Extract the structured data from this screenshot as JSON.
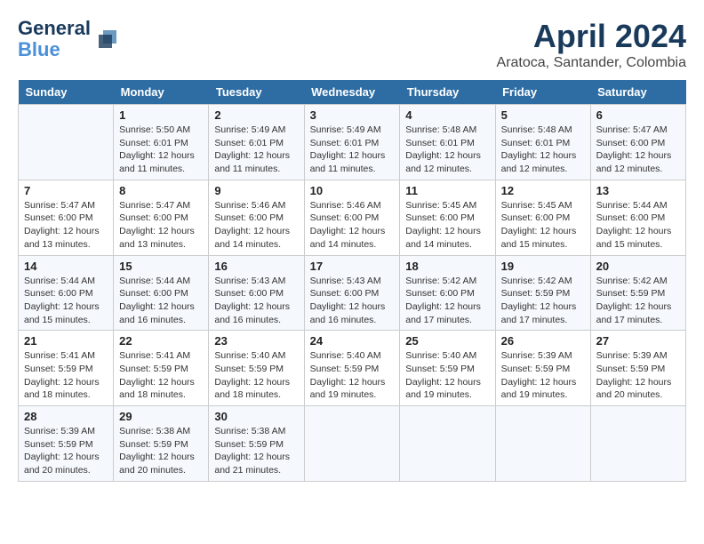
{
  "header": {
    "logo_line1": "General",
    "logo_line2": "Blue",
    "month": "April 2024",
    "location": "Aratoca, Santander, Colombia"
  },
  "weekdays": [
    "Sunday",
    "Monday",
    "Tuesday",
    "Wednesday",
    "Thursday",
    "Friday",
    "Saturday"
  ],
  "weeks": [
    [
      {
        "day": "",
        "info": ""
      },
      {
        "day": "1",
        "info": "Sunrise: 5:50 AM\nSunset: 6:01 PM\nDaylight: 12 hours\nand 11 minutes."
      },
      {
        "day": "2",
        "info": "Sunrise: 5:49 AM\nSunset: 6:01 PM\nDaylight: 12 hours\nand 11 minutes."
      },
      {
        "day": "3",
        "info": "Sunrise: 5:49 AM\nSunset: 6:01 PM\nDaylight: 12 hours\nand 11 minutes."
      },
      {
        "day": "4",
        "info": "Sunrise: 5:48 AM\nSunset: 6:01 PM\nDaylight: 12 hours\nand 12 minutes."
      },
      {
        "day": "5",
        "info": "Sunrise: 5:48 AM\nSunset: 6:01 PM\nDaylight: 12 hours\nand 12 minutes."
      },
      {
        "day": "6",
        "info": "Sunrise: 5:47 AM\nSunset: 6:00 PM\nDaylight: 12 hours\nand 12 minutes."
      }
    ],
    [
      {
        "day": "7",
        "info": "Sunrise: 5:47 AM\nSunset: 6:00 PM\nDaylight: 12 hours\nand 13 minutes."
      },
      {
        "day": "8",
        "info": "Sunrise: 5:47 AM\nSunset: 6:00 PM\nDaylight: 12 hours\nand 13 minutes."
      },
      {
        "day": "9",
        "info": "Sunrise: 5:46 AM\nSunset: 6:00 PM\nDaylight: 12 hours\nand 14 minutes."
      },
      {
        "day": "10",
        "info": "Sunrise: 5:46 AM\nSunset: 6:00 PM\nDaylight: 12 hours\nand 14 minutes."
      },
      {
        "day": "11",
        "info": "Sunrise: 5:45 AM\nSunset: 6:00 PM\nDaylight: 12 hours\nand 14 minutes."
      },
      {
        "day": "12",
        "info": "Sunrise: 5:45 AM\nSunset: 6:00 PM\nDaylight: 12 hours\nand 15 minutes."
      },
      {
        "day": "13",
        "info": "Sunrise: 5:44 AM\nSunset: 6:00 PM\nDaylight: 12 hours\nand 15 minutes."
      }
    ],
    [
      {
        "day": "14",
        "info": "Sunrise: 5:44 AM\nSunset: 6:00 PM\nDaylight: 12 hours\nand 15 minutes."
      },
      {
        "day": "15",
        "info": "Sunrise: 5:44 AM\nSunset: 6:00 PM\nDaylight: 12 hours\nand 16 minutes."
      },
      {
        "day": "16",
        "info": "Sunrise: 5:43 AM\nSunset: 6:00 PM\nDaylight: 12 hours\nand 16 minutes."
      },
      {
        "day": "17",
        "info": "Sunrise: 5:43 AM\nSunset: 6:00 PM\nDaylight: 12 hours\nand 16 minutes."
      },
      {
        "day": "18",
        "info": "Sunrise: 5:42 AM\nSunset: 6:00 PM\nDaylight: 12 hours\nand 17 minutes."
      },
      {
        "day": "19",
        "info": "Sunrise: 5:42 AM\nSunset: 5:59 PM\nDaylight: 12 hours\nand 17 minutes."
      },
      {
        "day": "20",
        "info": "Sunrise: 5:42 AM\nSunset: 5:59 PM\nDaylight: 12 hours\nand 17 minutes."
      }
    ],
    [
      {
        "day": "21",
        "info": "Sunrise: 5:41 AM\nSunset: 5:59 PM\nDaylight: 12 hours\nand 18 minutes."
      },
      {
        "day": "22",
        "info": "Sunrise: 5:41 AM\nSunset: 5:59 PM\nDaylight: 12 hours\nand 18 minutes."
      },
      {
        "day": "23",
        "info": "Sunrise: 5:40 AM\nSunset: 5:59 PM\nDaylight: 12 hours\nand 18 minutes."
      },
      {
        "day": "24",
        "info": "Sunrise: 5:40 AM\nSunset: 5:59 PM\nDaylight: 12 hours\nand 19 minutes."
      },
      {
        "day": "25",
        "info": "Sunrise: 5:40 AM\nSunset: 5:59 PM\nDaylight: 12 hours\nand 19 minutes."
      },
      {
        "day": "26",
        "info": "Sunrise: 5:39 AM\nSunset: 5:59 PM\nDaylight: 12 hours\nand 19 minutes."
      },
      {
        "day": "27",
        "info": "Sunrise: 5:39 AM\nSunset: 5:59 PM\nDaylight: 12 hours\nand 20 minutes."
      }
    ],
    [
      {
        "day": "28",
        "info": "Sunrise: 5:39 AM\nSunset: 5:59 PM\nDaylight: 12 hours\nand 20 minutes."
      },
      {
        "day": "29",
        "info": "Sunrise: 5:38 AM\nSunset: 5:59 PM\nDaylight: 12 hours\nand 20 minutes."
      },
      {
        "day": "30",
        "info": "Sunrise: 5:38 AM\nSunset: 5:59 PM\nDaylight: 12 hours\nand 21 minutes."
      },
      {
        "day": "",
        "info": ""
      },
      {
        "day": "",
        "info": ""
      },
      {
        "day": "",
        "info": ""
      },
      {
        "day": "",
        "info": ""
      }
    ]
  ]
}
